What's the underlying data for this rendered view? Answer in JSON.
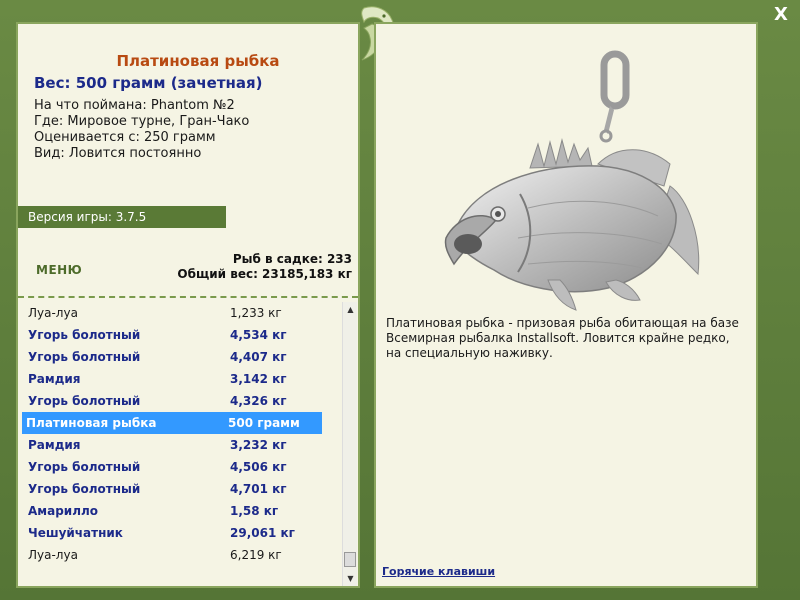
{
  "window": {
    "close_label": "X"
  },
  "fish": {
    "title": "Платиновая рыбка",
    "weight_line": "Вес: 500 грамм (зачетная)",
    "caught_with": "На что поймана: Phantom №2",
    "location": "Где: Мировое турне, Гран-Чако",
    "valued_from": "Оценивается с: 250 грамм",
    "type": "Вид: Ловится постоянно",
    "description": "Платиновая рыбка - призовая рыба обитающая на базе Всемирная рыбалка Installsoft. Ловится крайне редко, на специальную наживку."
  },
  "version": {
    "label": "Версия игры: 3.7.5"
  },
  "menu": {
    "label": "МЕНЮ"
  },
  "stats": {
    "fish_count": "Рыб в садке: 233",
    "total_weight": "Общий вес: 23185,183 кг"
  },
  "catch_list": [
    {
      "name": "Луа-луа",
      "weight": "1,233 кг",
      "style": "plain"
    },
    {
      "name": "Угорь болотный",
      "weight": "4,534 кг",
      "style": "bold"
    },
    {
      "name": "Угорь болотный",
      "weight": "4,407 кг",
      "style": "bold"
    },
    {
      "name": "Рамдия",
      "weight": "3,142 кг",
      "style": "bold"
    },
    {
      "name": "Угорь болотный",
      "weight": "4,326 кг",
      "style": "bold"
    },
    {
      "name": "Платиновая рыбка",
      "weight": "500 грамм",
      "style": "selected"
    },
    {
      "name": "Рамдия",
      "weight": "3,232 кг",
      "style": "bold"
    },
    {
      "name": "Угорь болотный",
      "weight": "4,506 кг",
      "style": "bold"
    },
    {
      "name": "Угорь болотный",
      "weight": "4,701 кг",
      "style": "bold"
    },
    {
      "name": "Амарилло",
      "weight": "1,58 кг",
      "style": "bold"
    },
    {
      "name": "Чешуйчатник",
      "weight": "29,061 кг",
      "style": "bold"
    },
    {
      "name": "Луа-луа",
      "weight": "6,219 кг",
      "style": "plain"
    }
  ],
  "hotkeys": {
    "label": "Горячие клавиши"
  },
  "colors": {
    "frame_green": "#5b7a3a",
    "panel_bg": "#f5f4e4",
    "title_orange": "#b84a12",
    "text_blue": "#1c2a8a",
    "selection_blue": "#3399ff"
  },
  "icons": {
    "logo": "dolphin-logo-icon",
    "close": "close-icon",
    "scroll_up": "arrow-up-icon",
    "scroll_down": "arrow-down-icon"
  }
}
